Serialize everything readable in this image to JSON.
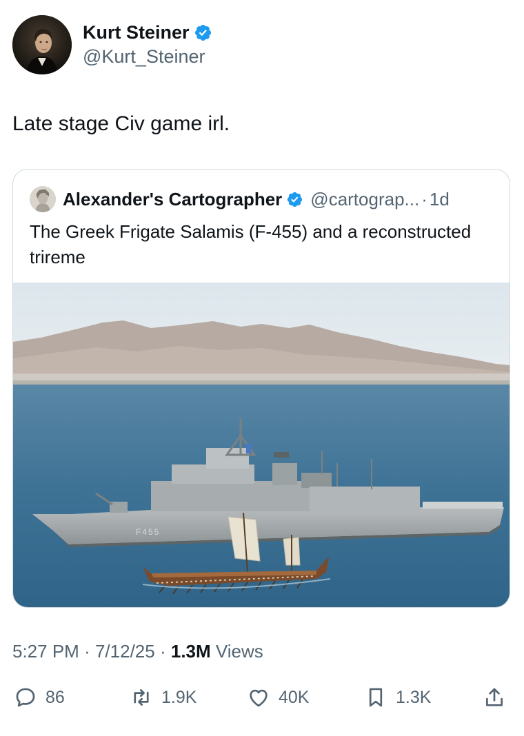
{
  "author": {
    "name": "Kurt Steiner",
    "handle": "@Kurt_Steiner",
    "avatar_icon": "portrait-avatar",
    "verified_icon": "verified-badge-icon"
  },
  "tweet": {
    "text": "Late stage Civ game irl."
  },
  "quote": {
    "name": "Alexander's Cartographer",
    "handle": "@cartograp...",
    "separator": "·",
    "time": "1d",
    "text": "The Greek Frigate Salamis (F-455) and a reconstructed trireme",
    "image_hull_marking": "F455"
  },
  "meta": {
    "time": "5:27 PM",
    "date": "7/12/25",
    "views_count": "1.3M",
    "views_label": "Views",
    "separator": "·"
  },
  "actions": {
    "replies": "86",
    "reposts": "1.9K",
    "likes": "40K",
    "bookmarks": "1.3K"
  },
  "colors": {
    "verified": "#1d9bf0",
    "secondary_text": "#536471",
    "primary_text": "#0f1419"
  }
}
